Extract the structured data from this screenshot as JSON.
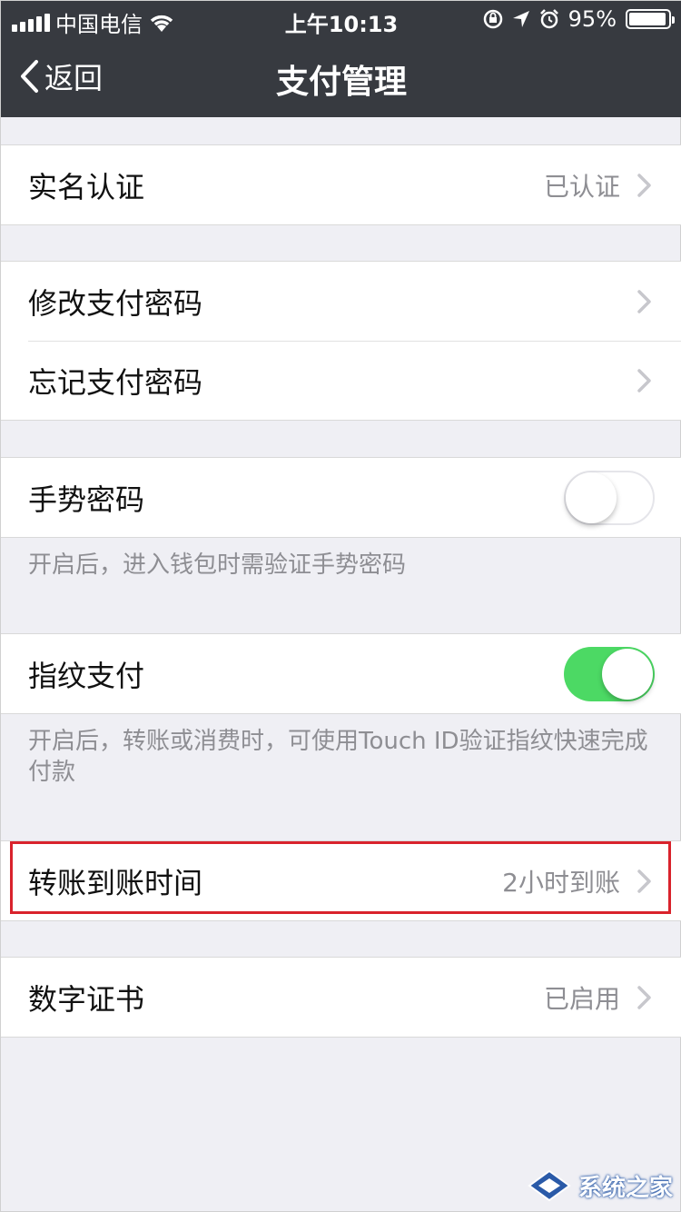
{
  "status_bar": {
    "carrier": "中国电信",
    "time": "上午10:13",
    "battery_percent": "95%",
    "battery_level": 0.95
  },
  "nav": {
    "back_label": "返回",
    "title": "支付管理"
  },
  "rows": {
    "real_name": {
      "label": "实名认证",
      "value": "已认证"
    },
    "change_password": {
      "label": "修改支付密码"
    },
    "forgot_password": {
      "label": "忘记支付密码"
    },
    "gesture": {
      "label": "手势密码",
      "enabled": false,
      "note": "开启后，进入钱包时需验证手势密码"
    },
    "fingerprint": {
      "label": "指纹支付",
      "enabled": true,
      "note": "开启后，转账或消费时，可使用Touch ID验证指纹快速完成付款"
    },
    "transfer_time": {
      "label": "转账到账时间",
      "value": "2小时到账"
    },
    "certificate": {
      "label": "数字证书",
      "value": "已启用"
    }
  },
  "colors": {
    "header_bg": "#373a40",
    "switch_on": "#4cd964",
    "highlight": "#d9232c",
    "page_bg": "#efeff4"
  },
  "icons": [
    "signal-icon",
    "wifi-icon",
    "lock-rotation-icon",
    "location-icon",
    "alarm-icon",
    "battery-icon",
    "back-chevron-icon",
    "chevron-right-icon",
    "watermark-logo-icon"
  ],
  "watermark": {
    "text": "系统之家"
  }
}
